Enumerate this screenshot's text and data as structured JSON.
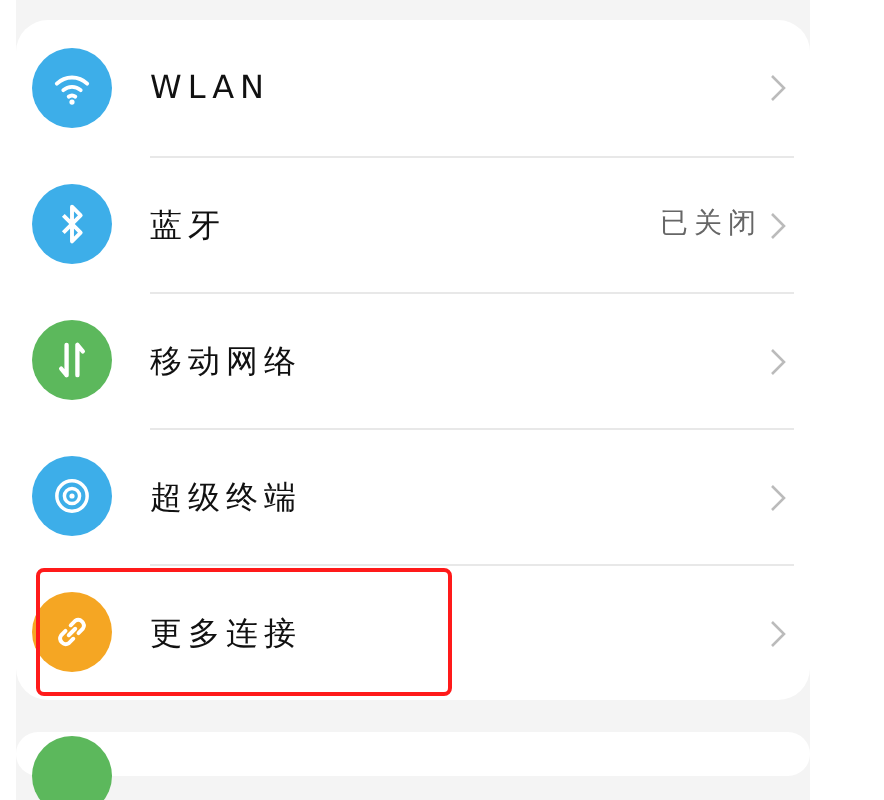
{
  "sections": [
    {
      "items": [
        {
          "kind": "wifi",
          "color": "#3daee9",
          "label": "WLAN",
          "highlighted": false
        },
        {
          "kind": "bluetooth",
          "color": "#3daee9",
          "label": "蓝牙",
          "value": "已关闭",
          "highlighted": false
        },
        {
          "kind": "mobile-data",
          "color": "#5cb85c",
          "label": "移动网络",
          "highlighted": false
        },
        {
          "kind": "devices",
          "color": "#3daee9",
          "label": "超级终端",
          "highlighted": false
        },
        {
          "kind": "link",
          "color": "#f5a623",
          "label": "更多连接",
          "highlighted": true
        }
      ]
    },
    {
      "items": [
        {
          "kind": "partial",
          "color": "#5cb85c"
        }
      ]
    }
  ]
}
